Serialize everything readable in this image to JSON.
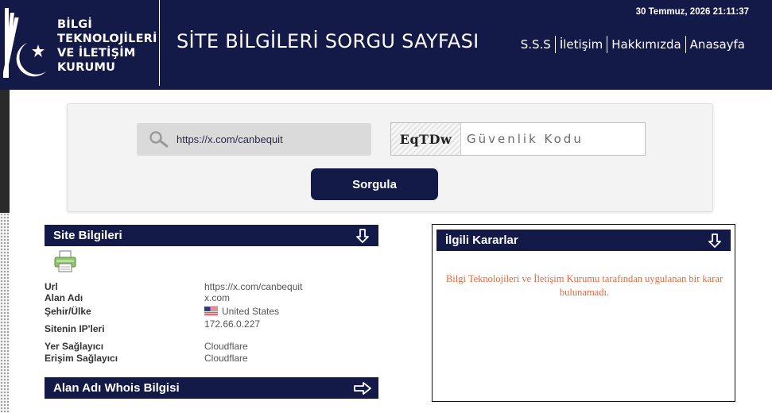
{
  "header": {
    "org_name_lines": [
      "BİLGİ",
      "TEKNOLOJİLERİ",
      "VE İLETİŞİM",
      "KURUMU"
    ],
    "page_title": "SİTE BİLGİLERİ SORGU SAYFASI",
    "datetime": "30 Temmuz, 2026 21:11:37",
    "nav": [
      {
        "label": "S.S.S"
      },
      {
        "label": "İletişim"
      },
      {
        "label": "Hakkımızda"
      },
      {
        "label": "Anasayfa"
      }
    ]
  },
  "search": {
    "url_value": "https://x.com/canbequit",
    "captcha_code": "EqTDw",
    "captcha_placeholder": "Güvenlik Kodu",
    "submit_label": "Sorgula"
  },
  "site_info": {
    "title": "Site Bilgileri",
    "rows": [
      {
        "label": "Url",
        "value": "https://x.com/canbequit"
      },
      {
        "label": "Alan Adı",
        "value": "x.com"
      },
      {
        "label": "Şehir/Ülke",
        "value": "United States"
      },
      {
        "label": "Sitenin IP'leri",
        "value": "172.66.0.227"
      },
      {
        "label": "Yer Sağlayıcı",
        "value": "Cloudflare"
      },
      {
        "label": "Erişim Sağlayıcı",
        "value": "Cloudflare"
      }
    ]
  },
  "whois": {
    "title": "Alan Adı Whois Bilgisi"
  },
  "decisions": {
    "title": "İlgili Kararlar",
    "message": "Bilgi Teknolojileri ve İletişim Kurumu tarafından uygulanan bir karar bulunamadı."
  },
  "colors": {
    "navy": "#141a47",
    "accent_text": "#e2683a"
  }
}
